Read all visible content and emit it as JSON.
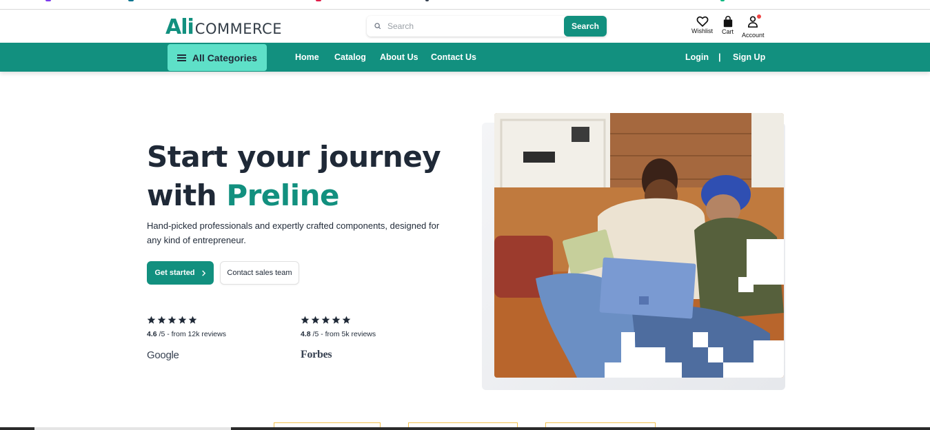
{
  "brand": {
    "logo_primary": "Ali",
    "logo_secondary": "COMMERCE",
    "accent_color": "#12907f",
    "accent_light": "#5ee0c8"
  },
  "search": {
    "placeholder": "Search",
    "button_label": "Search",
    "icon": "search-icon"
  },
  "header_icons": [
    {
      "label": "Wishlist",
      "icon": "heart-icon"
    },
    {
      "label": "Cart",
      "icon": "shopping-bag-icon"
    },
    {
      "label": "Account",
      "icon": "user-icon",
      "has_notification": true
    }
  ],
  "nav": {
    "categories_label": "All Categories",
    "links": [
      "Home",
      "Catalog",
      "About Us",
      "Contact Us"
    ],
    "login_label": "Login",
    "separator": "|",
    "signup_label": "Sign Up"
  },
  "hero": {
    "title_line1": "Start your journey",
    "title_line2_prefix": "with",
    "title_line2_accent": "Preline",
    "subtitle": "Hand-picked professionals and expertly crafted components, designed for any kind of entrepreneur.",
    "primary_button": "Get started",
    "secondary_button": "Contact sales team",
    "image": "two-friends-laughing-with-laptop-photo"
  },
  "reviews": [
    {
      "stars": 5,
      "score": "4.6",
      "suffix": "/5 - from 12k reviews",
      "brand": "Google"
    },
    {
      "stars": 5,
      "score": "4.8",
      "suffix": "/5 - from 5k reviews",
      "brand": "Forbes"
    }
  ]
}
